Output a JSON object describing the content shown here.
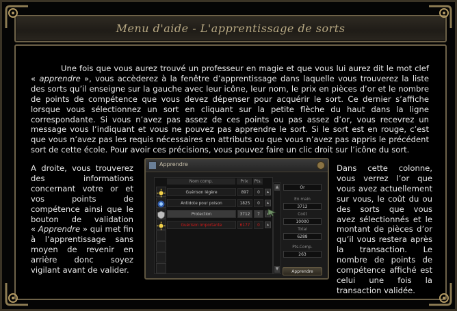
{
  "header": {
    "title": "Menu d'aide - L'apprentissage de sorts"
  },
  "intro": {
    "part1": "Une fois que vous aurez trouvé un professeur en magie et que vous lui aurez dit le mot clef « ",
    "keyword": "apprendre",
    "part2": " », vous accèderez à la fenêtre d’apprentissage dans laquelle vous trouverez la liste des sorts qu’il enseigne sur la gauche avec leur icône, leur nom, le prix en pièces d’or et le nombre de points de compétence que vous devez dépenser pour acquérir le sort. Ce dernier s’affiche lorsque vous sélectionnez un sort en cliquant sur la petite flèche du haut dans la ligne correspondante. Si vous n’avez pas assez de ces points ou pas assez d’or, vous recevrez un message vous l’indiquant et vous ne pouvez pas apprendre le sort. Si le sort est en rouge, c’est que vous n’avez pas les requis nécessaires en attributs ou que vous n’avez pas appris le précédent sort de cette école. Pour avoir ces précisions, vous pouvez faire un clic droit sur l’icône du sort."
  },
  "left_column": {
    "part1": "A droite, vous trouverez des informations concernant votre or et vos points de compétence ainsi que le bouton de validation « ",
    "keyword": "Apprendre",
    "part2": " » qui met fin à l’apprentissage sans moyen de revenir en arrière donc soyez vigilant avant de valider."
  },
  "right_column": {
    "text": "Dans cette colonne, vous verrez l’or que vous avez actuellement sur vous, le coût du ou des sorts que vous avez sélectionnés et le montant de pièces d’or qu’il vous restera après la transaction. Le nombre de points de compétence affiché est celui une fois la transaction validée."
  },
  "game_window": {
    "title": "Apprendre",
    "columns": {
      "name": "Nom comp.",
      "price": "Prix",
      "points": "Pts."
    },
    "spells": [
      {
        "name": "Guérison légère",
        "price": "897",
        "points": "0",
        "icon": "sun-icon",
        "color": "#c8c8c8"
      },
      {
        "name": "Antidote pour poison",
        "price": "1825",
        "points": "0",
        "icon": "orb-icon",
        "color": "#c8c8c8"
      },
      {
        "name": "Protection",
        "price": "3712",
        "points": "7",
        "icon": "shield-icon",
        "color": "#c8c8c8"
      },
      {
        "name": "Guérison importante",
        "price": "6177",
        "points": "0",
        "icon": "sun-icon",
        "color": "#d21a1a"
      }
    ],
    "stats": {
      "gold_label": "Or",
      "in_hand_label": "En main",
      "in_hand_value": "3712",
      "cost_label": "Coût",
      "cost_value": "10000",
      "total_label": "Total",
      "total_value": "6288",
      "points_label": "Pts.Comp.",
      "points_value": "263"
    },
    "learn_button": "Apprendre"
  }
}
